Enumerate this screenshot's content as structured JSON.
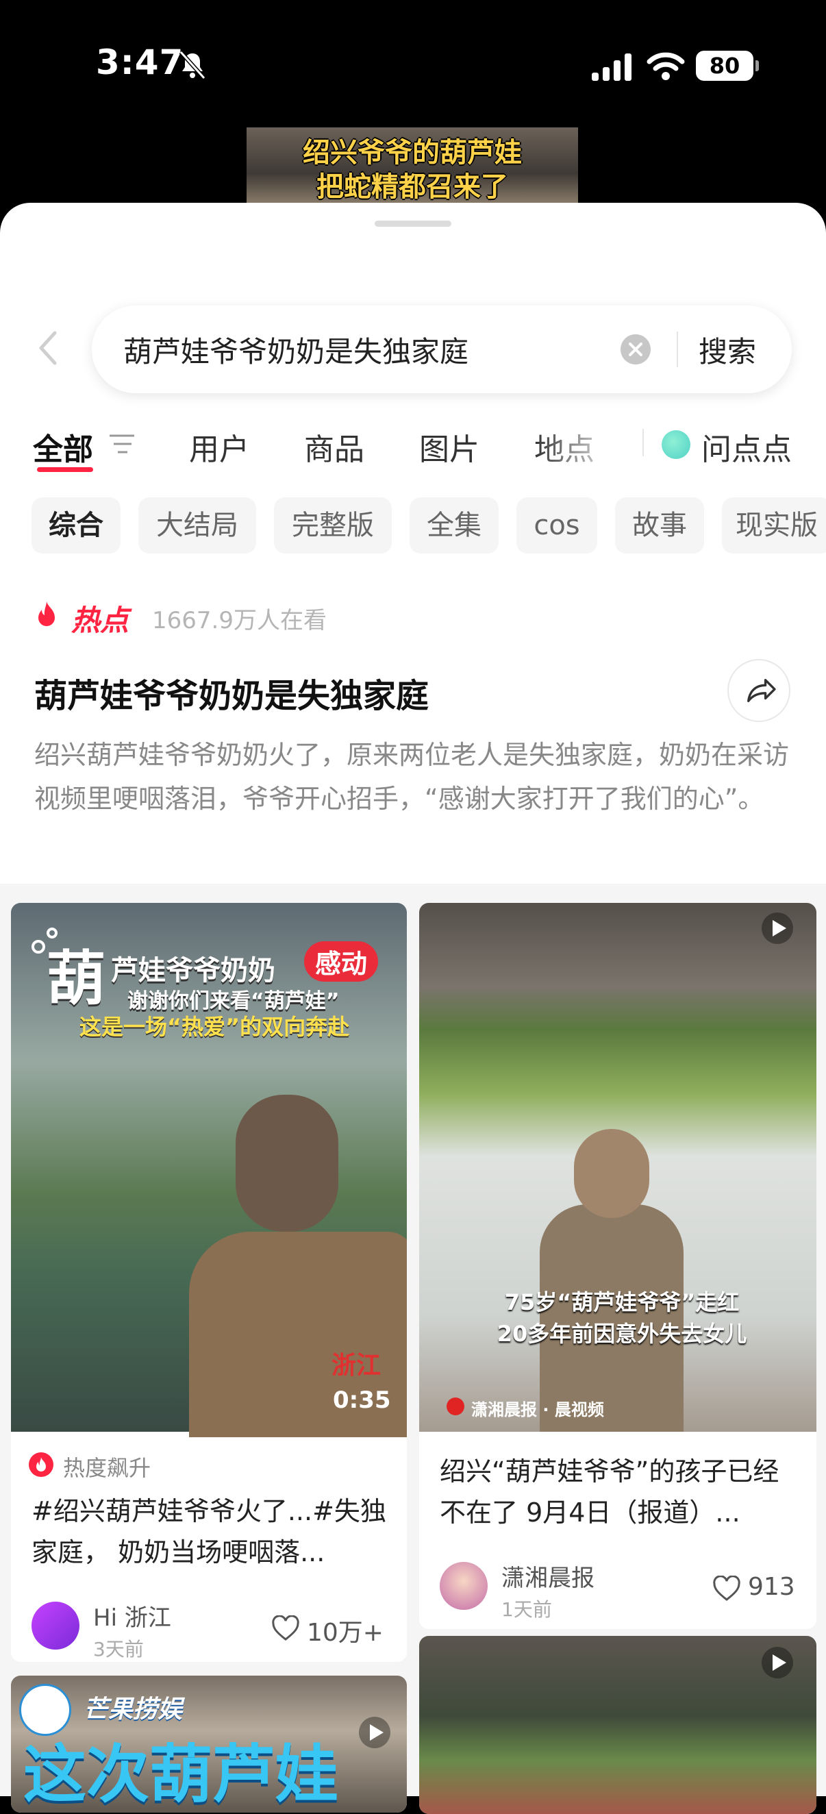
{
  "status_bar": {
    "time": "3:47",
    "battery": "80"
  },
  "top_video": {
    "line1": "绍兴爷爷的葫芦娃",
    "line2": "把蛇精都召来了"
  },
  "search": {
    "query": "葫芦娃爷爷奶奶是失独家庭",
    "button": "搜索"
  },
  "tabs": [
    {
      "label": "全部"
    },
    {
      "label": "用户"
    },
    {
      "label": "商品"
    },
    {
      "label": "图片"
    },
    {
      "label": "地点"
    },
    {
      "label": "问点点"
    }
  ],
  "chips": [
    "综合",
    "大结局",
    "完整版",
    "全集",
    "cos",
    "故事",
    "现实版"
  ],
  "hot": {
    "label": "热点",
    "views": "1667.9万人在看",
    "title": "葫芦娃爷爷奶奶是失独家庭",
    "description": "绍兴葫芦娃爷爷奶奶火了，原来两位老人是失独家庭，奶奶在采访视频里哽咽落泪，爷爷开心招手，“感谢大家打开了我们的心”。"
  },
  "cards": [
    {
      "overlay_title_big": "葫",
      "overlay_title": "芦娃爷爷奶奶",
      "overlay_badge": "感动",
      "overlay_line2": "谢谢你们来看“葫芦娃”",
      "overlay_line3": "这是一场“热爱”的双向奔赴",
      "watermark": "浙江",
      "duration": "0:35",
      "trend": "热度飙升",
      "title": "#绍兴葫芦娃爷爷火了...#失独家庭， 奶奶当场哽咽落...",
      "author": "Hi 浙江",
      "time": "3天前",
      "likes": "10万+"
    },
    {
      "overlay_line1": "75岁“葫芦娃爷爷”走红",
      "overlay_line2": "20多年前因意外失去女儿",
      "source": "潇湘晨报 · 晨视频",
      "title": "绍兴“葫芦娃爷爷”的孩子已经不在了 9月4日（报道）...",
      "author": "潇湘晨报",
      "time": "1天前",
      "likes": "913"
    },
    {
      "overlay_brand": "芒果捞娱",
      "overlay_big": "这次葫芦娃"
    },
    {}
  ]
}
